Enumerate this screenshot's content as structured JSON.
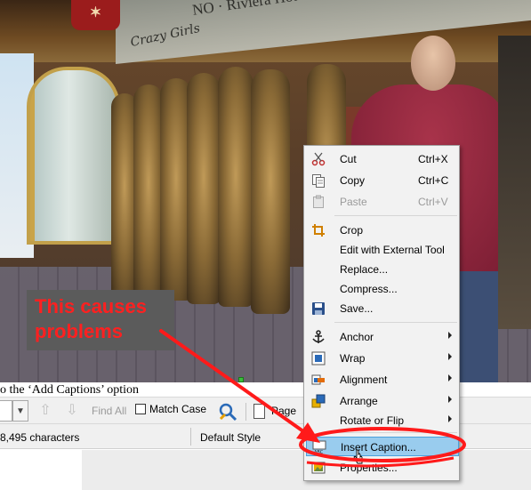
{
  "photo": {
    "sign_text": "NO ·  Riviera Hotel & Casino",
    "sign_script": "Crazy Girls",
    "alt": ""
  },
  "callout": {
    "line1": "This causes",
    "line2": "problems"
  },
  "document": {
    "visible_text": "o the ‘Add Captions’ option"
  },
  "findbar": {
    "find_all_label": "Find All",
    "match_case_label": "Match Case",
    "page_label": "Page"
  },
  "statusbar": {
    "characters": "8,495 characters",
    "page_style": "Default Style"
  },
  "context_menu": {
    "items": [
      {
        "label": "Cut",
        "shortcut": "Ctrl+X",
        "icon": "scissors-icon",
        "enabled": true
      },
      {
        "label": "Copy",
        "shortcut": "Ctrl+C",
        "icon": "copy-icon",
        "enabled": true
      },
      {
        "label": "Paste",
        "shortcut": "Ctrl+V",
        "icon": "paste-icon",
        "enabled": false
      },
      {
        "label": "Crop",
        "shortcut": "",
        "icon": "crop-icon",
        "enabled": true
      },
      {
        "label": "Edit with External Tool",
        "shortcut": "",
        "icon": "",
        "enabled": true
      },
      {
        "label": "Replace...",
        "shortcut": "",
        "icon": "",
        "enabled": true
      },
      {
        "label": "Compress...",
        "shortcut": "",
        "icon": "",
        "enabled": true
      },
      {
        "label": "Save...",
        "shortcut": "",
        "icon": "save-icon",
        "enabled": true
      },
      {
        "label": "Anchor",
        "shortcut": "",
        "icon": "anchor-icon",
        "enabled": true,
        "submenu": true
      },
      {
        "label": "Wrap",
        "shortcut": "",
        "icon": "wrap-icon",
        "enabled": true,
        "submenu": true
      },
      {
        "label": "Alignment",
        "shortcut": "",
        "icon": "alignment-icon",
        "enabled": true,
        "submenu": true
      },
      {
        "label": "Arrange",
        "shortcut": "",
        "icon": "arrange-icon",
        "enabled": true,
        "submenu": true
      },
      {
        "label": "Rotate or Flip",
        "shortcut": "",
        "icon": "",
        "enabled": true,
        "submenu": true
      },
      {
        "label": "Insert Caption...",
        "shortcut": "",
        "icon": "insert-caption-icon",
        "enabled": true,
        "highlighted": true
      },
      {
        "label": "Properties...",
        "shortcut": "",
        "icon": "properties-icon",
        "enabled": true
      }
    ]
  },
  "colors": {
    "annotation_red": "#ff1a1a",
    "menu_highlight": "#99ccee",
    "callout_bg": "#5b5b5b"
  }
}
